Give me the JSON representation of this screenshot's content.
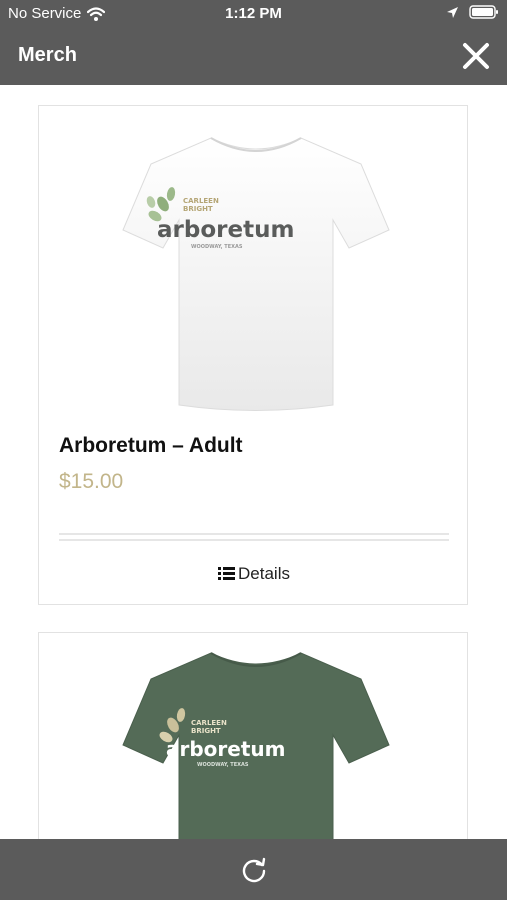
{
  "status_bar": {
    "carrier": "No Service",
    "time": "1:12 PM"
  },
  "header": {
    "title": "Merch"
  },
  "products": [
    {
      "name": "Arboretum – Adult",
      "price": "$15.00",
      "details_label": "Details",
      "shirt_color": "#f4f4f4",
      "logo": {
        "line1": "CARLEEN",
        "line2": "BRIGHT",
        "word": "arboretum",
        "tagline": "WOODWAY, TEXAS"
      }
    },
    {
      "shirt_color": "#546b57",
      "logo": {
        "line1": "CARLEEN",
        "line2": "BRIGHT",
        "word": "arboretum",
        "tagline": "WOODWAY, TEXAS"
      }
    }
  ],
  "colors": {
    "bar_background": "#5b5b5b",
    "price": "#c2b58a"
  },
  "icons": {
    "close": "close-icon",
    "refresh": "refresh-icon",
    "details": "list-icon",
    "wifi": "wifi-icon",
    "location": "location-arrow-icon",
    "battery": "battery-icon"
  }
}
